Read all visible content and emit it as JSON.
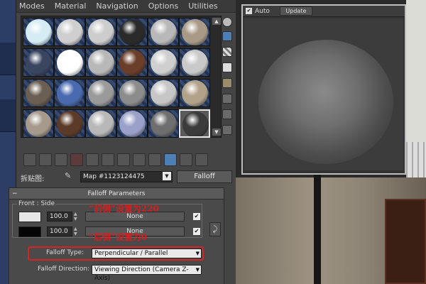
{
  "menu": [
    "Modes",
    "Material",
    "Navigation",
    "Options",
    "Utilities"
  ],
  "slots": [
    [
      "#d6ecf5",
      "#cfcfcf",
      "#cdcdcd",
      "#2a2a2a",
      "#b8b8b8",
      "#a89a86"
    ],
    [
      "#3a4560",
      "#ffffff",
      "#b8b8b8",
      "#6b3e2a",
      "#cfcfcf",
      "#c9c9c9"
    ],
    [
      "#6b5e52",
      "#4a6ab0",
      "#9a9a9a",
      "#8c8c8c",
      "#c6c6c6",
      "#b2a289"
    ],
    [
      "#a59a8c",
      "#5b3a28",
      "#b8b8b8",
      "#9aa0c8",
      "#6e6e6e",
      "#3b3b3b"
    ]
  ],
  "map": {
    "label": "拆贴图:",
    "name": "Map #1123124475",
    "type_button": "Falloff"
  },
  "rollout": {
    "title": "Falloff Parameters",
    "front_side_label": "Front : Side",
    "row1": {
      "value": "100.0",
      "map": "None",
      "color": "#e6e6e6"
    },
    "row2": {
      "value": "100.0",
      "map": "None",
      "color": "#050505"
    },
    "annotation1": "“前侧”设置为220",
    "annotation2": "“后侧”设置为0",
    "falloff_type_label": "Falloff Type:",
    "falloff_type_value": "Perpendicular / Parallel",
    "falloff_direction_label": "Falloff Direction:",
    "falloff_direction_value": "Viewing Direction (Camera Z-Axis)"
  },
  "preview": {
    "auto_label": "Auto",
    "update_label": "Update"
  }
}
